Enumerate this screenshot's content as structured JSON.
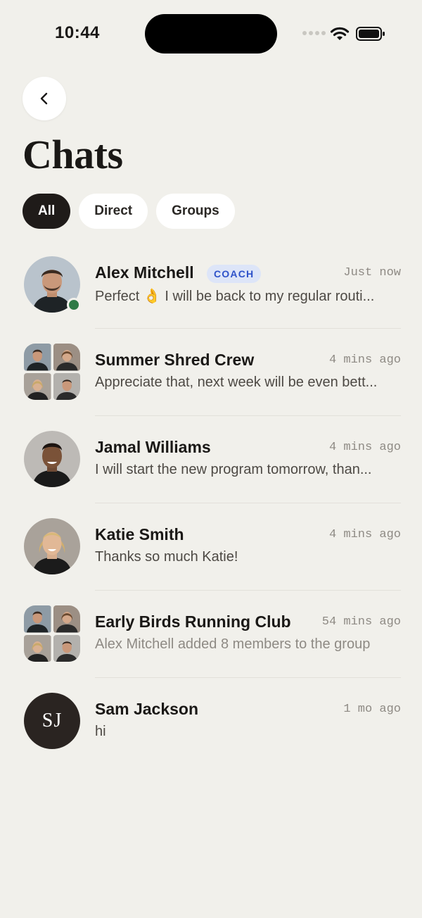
{
  "status": {
    "time": "10:44"
  },
  "title": "Chats",
  "filters": [
    {
      "label": "All",
      "active": true
    },
    {
      "label": "Direct",
      "active": false
    },
    {
      "label": "Groups",
      "active": false
    }
  ],
  "chats": [
    {
      "name": "Alex Mitchell",
      "badge": "COACH",
      "time": "Just now",
      "message": "Perfect 👌 I will be back to my regular routi...",
      "online": true
    },
    {
      "name": "Summer Shred Crew",
      "time": "4 mins ago",
      "message": "Appreciate that, next week will be even bett..."
    },
    {
      "name": "Jamal Williams",
      "time": "4 mins ago",
      "message": "I will start the new program tomorrow, than..."
    },
    {
      "name": "Katie Smith",
      "time": "4 mins ago",
      "message": "Thanks so much Katie!"
    },
    {
      "name": "Early Birds Running Club",
      "time": "54 mins ago",
      "message": "Alex Mitchell added 8 members to the group"
    },
    {
      "name": "Sam Jackson",
      "initials": "SJ",
      "time": "1 mo ago",
      "message": "hi"
    }
  ],
  "colors": {
    "background": "#F1F0EB",
    "active_chip": "#1F1B19",
    "coach_badge_bg": "#DDE5F8",
    "coach_badge_text": "#2E52C9",
    "online": "#2F7A46"
  }
}
